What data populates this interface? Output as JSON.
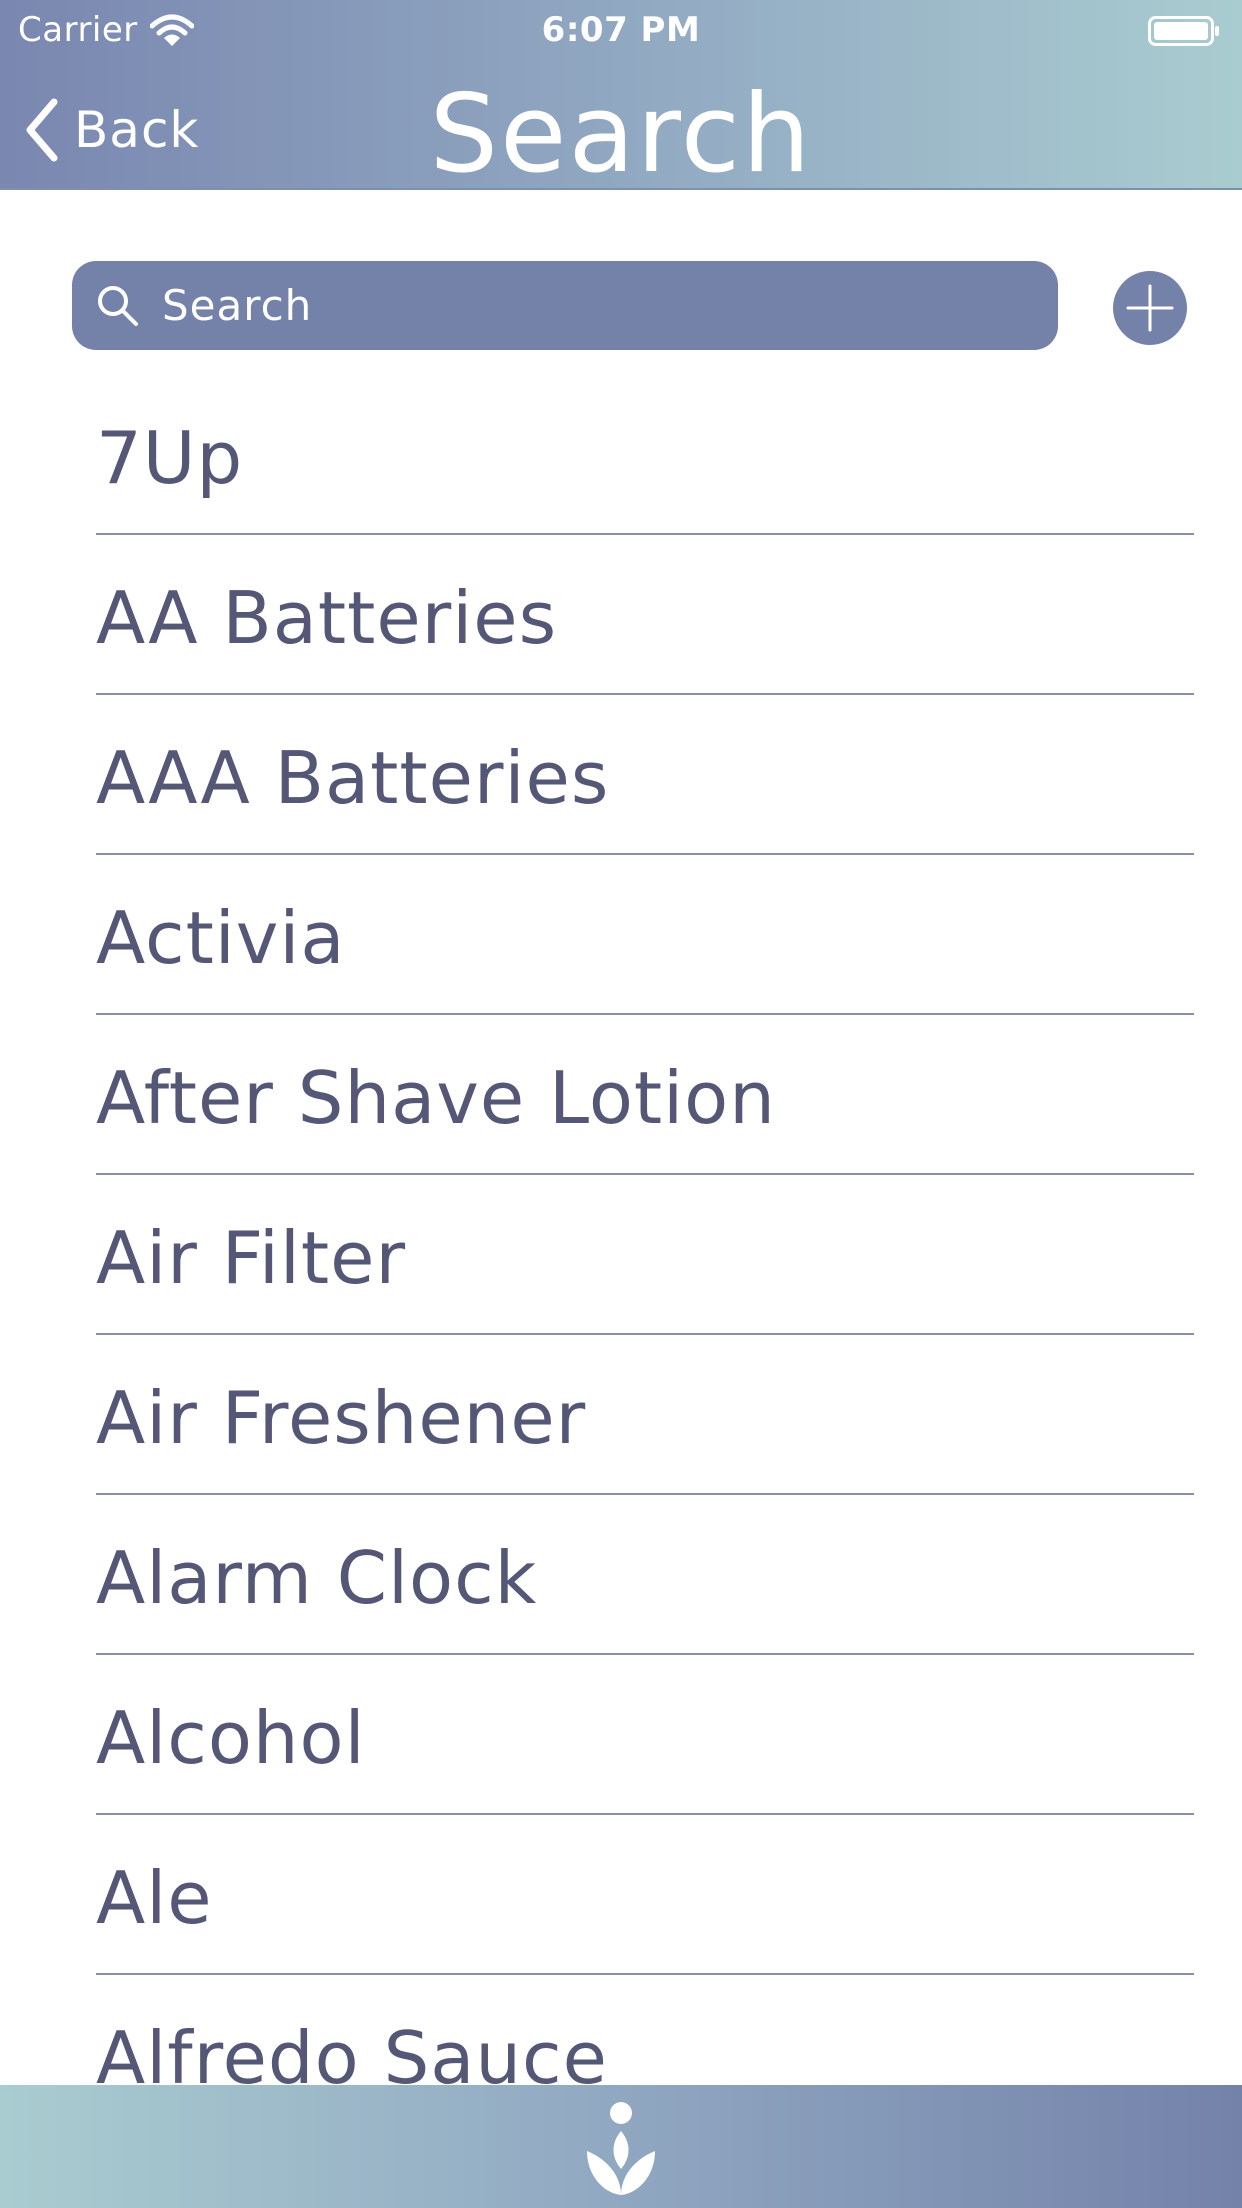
{
  "status_bar": {
    "carrier": "Carrier",
    "time": "6:07 PM",
    "icons": [
      "wifi-icon",
      "battery-icon"
    ]
  },
  "nav": {
    "back_label": "Back",
    "title": "Search"
  },
  "search": {
    "placeholder": "Search",
    "value": ""
  },
  "items": [
    "7Up",
    "AA Batteries",
    "AAA Batteries",
    "Activia",
    "After Shave Lotion",
    "Air Filter",
    "Air Freshener",
    "Alarm Clock",
    "Alcohol",
    "Ale",
    "Alfredo Sauce"
  ],
  "colors": {
    "header_gradient_start": "#7a87b0",
    "header_gradient_end": "#a9ccd0",
    "accent": "#7482aa",
    "text": "#545775",
    "divider": "#8c8ea6"
  }
}
